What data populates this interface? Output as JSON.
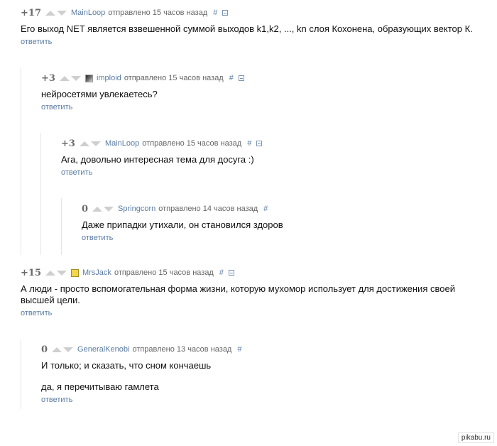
{
  "comments": [
    {
      "rating": "+17",
      "author": "MainLoop",
      "meta": "отправлено 15 часов назад",
      "hash": "#",
      "body": [
        "Его выход NET является взвешенной суммой выходов k1,k2, ..., kn слоя Кохонена, образующих вектор К."
      ],
      "reply": "ответить"
    },
    {
      "rating": "+3",
      "author": "imploid",
      "avatar": "user-avatar",
      "meta": "отправлено 15 часов назад",
      "hash": "#",
      "body": [
        "нейросетями увлекаетесь?"
      ],
      "reply": "ответить"
    },
    {
      "rating": "+3",
      "author": "MainLoop",
      "meta": "отправлено 15 часов назад",
      "hash": "#",
      "body": [
        "Ага, довольно интересная тема для досуга :)"
      ],
      "reply": "ответить"
    },
    {
      "rating": "0",
      "author": "Springcorn",
      "meta": "отправлено 14 часов назад",
      "hash": "#",
      "body": [
        "Даже припадки утихали, он становился здоров"
      ],
      "reply": "ответить"
    },
    {
      "rating": "+15",
      "author": "MrsJack",
      "avatar": "user-avatar",
      "meta": "отправлено 15 часов назад",
      "hash": "#",
      "body": [
        "А люди - просто вспомогательная форма жизни, которую мухомор использует для достижения своей высшей цели."
      ],
      "reply": "ответить"
    },
    {
      "rating": "0",
      "author": "GeneralKenobi",
      "meta": "отправлено 13 часов назад",
      "hash": "#",
      "body": [
        "И только; и сказать, что сном кончаешь",
        "да, я перечитываю гамлета"
      ],
      "reply": "ответить"
    }
  ],
  "watermark": "pikabu.ru"
}
